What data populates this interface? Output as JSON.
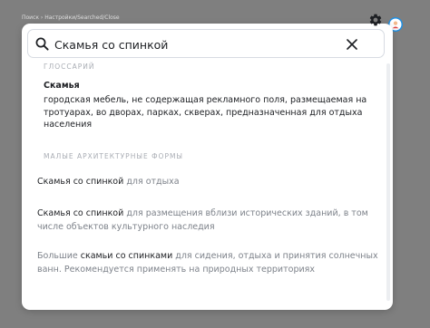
{
  "breadcrumb": "Поиск › Настройки/Searched/Close",
  "search": {
    "value": "Скамья со спинкой",
    "placeholder": ""
  },
  "glossary": {
    "section_title": "ГЛОССАРИЙ",
    "term": "Скамья",
    "definition": "городская мебель, не содержащая рекламного поля, размещаемая на тротуарах, во дворах, парках, скверах, предназначенная для отдыха населения"
  },
  "architecture": {
    "section_title": "МАЛЫЕ АРХИТЕКТУРНЫЕ ФОРМЫ",
    "results": [
      {
        "before": "",
        "highlight": "Скамья со спинкой",
        "after": " для отдыха"
      },
      {
        "before": "",
        "highlight": "Скамья со спинкой",
        "after": " для размещения вблизи исторических зданий, в том числе объектов культурного наследия"
      },
      {
        "before": "Большие ",
        "highlight": "скамьи со спинками",
        "after": " для сидения, отдыха и принятия солнечных ванн. Рекомендуется применять на природных территориях"
      }
    ]
  },
  "colors": {
    "backdrop": "#7f7f7f",
    "panel": "#ffffff",
    "text": "#1d1f23",
    "muted": "#7d828a",
    "section": "#a9adb4",
    "avatar": "#1f8fe3"
  },
  "icons": {
    "search": "search-icon",
    "clear": "close-icon",
    "settings": "gear-icon",
    "avatar": "user-avatar"
  }
}
